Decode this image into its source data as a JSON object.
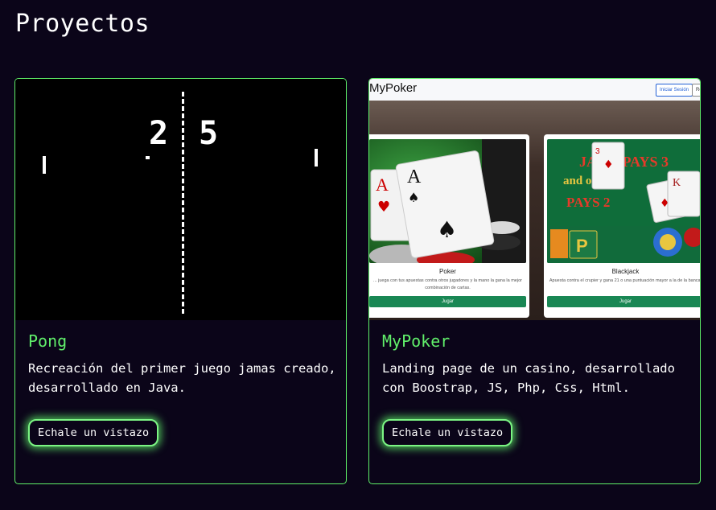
{
  "page": {
    "title": "Proyectos"
  },
  "projects": [
    {
      "title": "Pong",
      "description": "Recreación del primer juego jamas creado, desarrollado en Java.",
      "button_label": "Echale un vistazo",
      "preview": {
        "score_left": "2",
        "score_right": "5"
      }
    },
    {
      "title": "MyPoker",
      "description": "Landing page de un casino, desarrollado con Boostrap, JS, Php, Css, Html.",
      "button_label": "Echale un vistazo",
      "preview": {
        "brand": "MyPoker",
        "login_label": "Iniciar Sesión",
        "register_label": "Reg",
        "games": [
          {
            "name": "Poker",
            "description": "... juega con tus apuestas contra otros jugadores y la mano la gana la mejor combinación de cartas.",
            "button": "Jugar"
          },
          {
            "name": "Blackjack",
            "description": "Apuesta contra el crupier y gana 21 o una puntuación mayor a la de la banca.",
            "button": "Jugar"
          }
        ]
      }
    }
  ],
  "colors": {
    "background": "#0b0519",
    "accent": "#61f06b",
    "text": "#ffffff",
    "button_green": "#198754"
  }
}
